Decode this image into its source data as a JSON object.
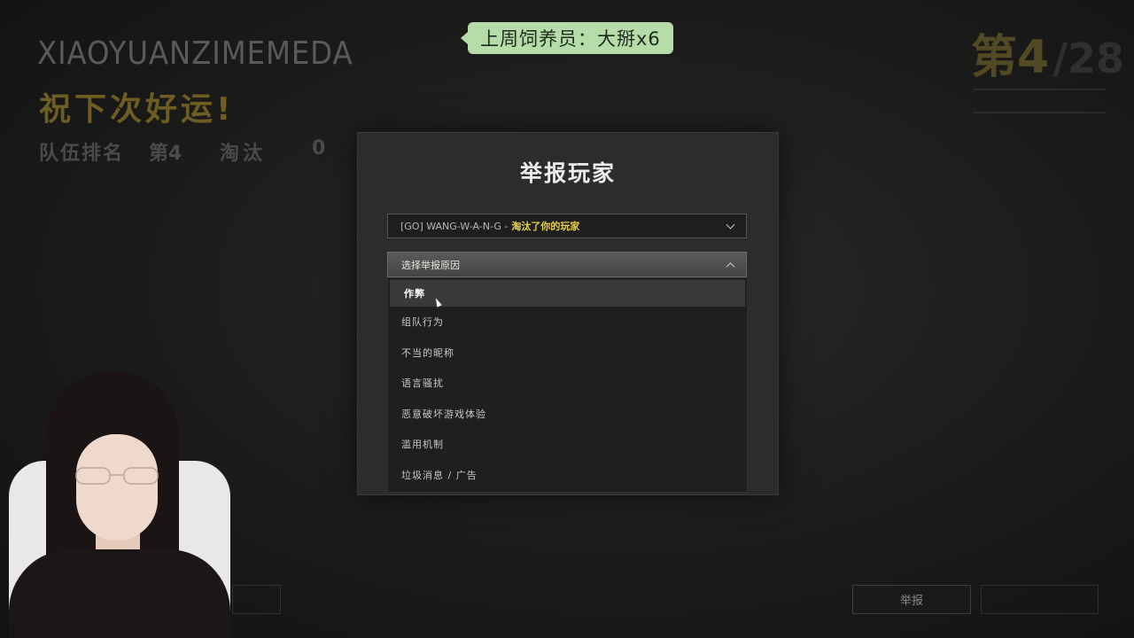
{
  "hud": {
    "player_name": "XIAOYUANZIMEMEDA",
    "good_luck": "祝下次好运!",
    "team_rank_label": "队伍排名",
    "team_rank_value": "第4",
    "eliminations_label": "淘汰",
    "eliminations_value": "0",
    "placement_main": "第4",
    "placement_total": "/28"
  },
  "overlay": {
    "feeder_text": "上周饲养员：大掰x6"
  },
  "modal": {
    "title": "举报玩家",
    "player_select": {
      "name": "[GO] WANG-W-A-N-G -",
      "relation": "淘汰了你的玩家"
    },
    "reason_select": {
      "placeholder": "选择举报原因"
    },
    "reasons": [
      "作弊",
      "组队行为",
      "不当的昵称",
      "语言骚扰",
      "恶意破坏游戏体验",
      "滥用机制",
      "垃圾消息 / 广告"
    ],
    "hovered_reason_index": 0
  },
  "footer": {
    "report_button": "举报"
  },
  "colors": {
    "accent_gold": "#6d5d22",
    "highlight_yellow": "#e8d14a",
    "badge_green": "#b5dca9"
  }
}
